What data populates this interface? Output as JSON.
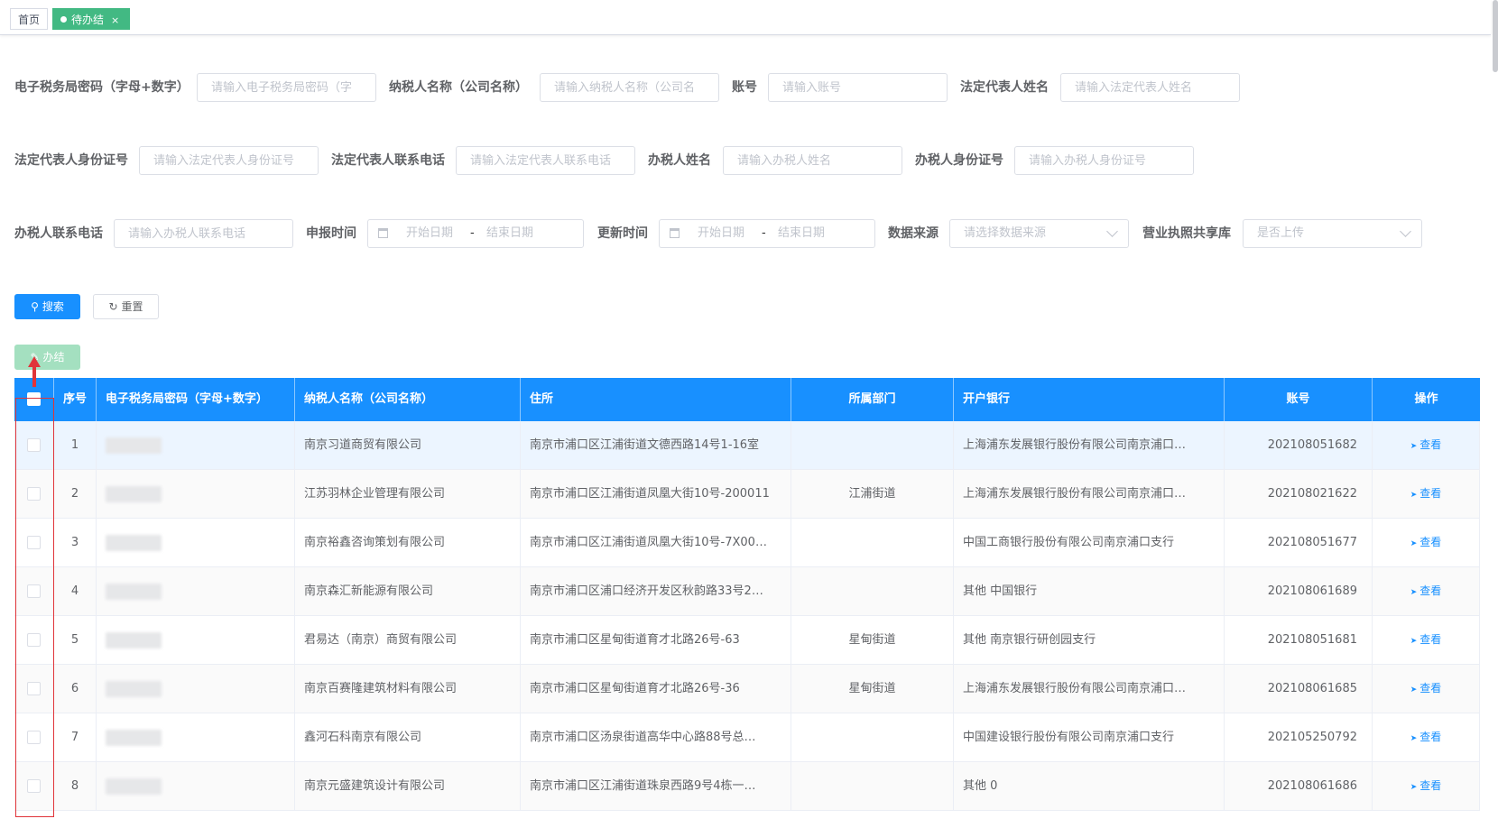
{
  "tabs": {
    "home": "首页",
    "active": "待办结",
    "close": "×"
  },
  "filters": {
    "row1": [
      {
        "label": "电子税务局密码（字母+数字）",
        "placeholder": "请输入电子税务局密码（字"
      },
      {
        "label": "纳税人名称（公司名称）",
        "placeholder": "请输入纳税人名称（公司名"
      },
      {
        "label": "账号",
        "placeholder": "请输入账号"
      },
      {
        "label": "法定代表人姓名",
        "placeholder": "请输入法定代表人姓名"
      }
    ],
    "row2": [
      {
        "label": "法定代表人身份证号",
        "placeholder": "请输入法定代表人身份证号"
      },
      {
        "label": "法定代表人联系电话",
        "placeholder": "请输入法定代表人联系电话"
      },
      {
        "label": "办税人姓名",
        "placeholder": "请输入办税人姓名"
      },
      {
        "label": "办税人身份证号",
        "placeholder": "请输入办税人身份证号"
      }
    ],
    "row3": {
      "contact_label": "办税人联系电话",
      "contact_placeholder": "请输入办税人联系电话",
      "report_label": "申报时间",
      "update_label": "更新时间",
      "start_placeholder": "开始日期",
      "sep": "-",
      "end_placeholder": "结束日期",
      "source_label": "数据来源",
      "source_placeholder": "请选择数据来源",
      "license_label": "营业执照共享库",
      "license_placeholder": "是否上传"
    }
  },
  "buttons": {
    "search": "搜索",
    "reset": "重置",
    "settle": "办结"
  },
  "table": {
    "headers": [
      "序号",
      "电子税务局密码（字母+数字）",
      "纳税人名称（公司名称）",
      "住所",
      "所属部门",
      "开户银行",
      "账号",
      "操作"
    ],
    "action_label": "查看",
    "rows": [
      {
        "no": "1",
        "name": "南京习道商贸有限公司",
        "address": "南京市浦口区江浦街道文德西路14号1-16室",
        "dept": "",
        "bank": "上海浦东发展银行股份有限公司南京浦口…",
        "account": "202108051682"
      },
      {
        "no": "2",
        "name": "江苏羽林企业管理有限公司",
        "address": "南京市浦口区江浦街道凤凰大街10号-200011",
        "dept": "江浦街道",
        "bank": "上海浦东发展银行股份有限公司南京浦口…",
        "account": "202108021622"
      },
      {
        "no": "3",
        "name": "南京裕鑫咨询策划有限公司",
        "address": "南京市浦口区江浦街道凤凰大街10号-7X00…",
        "dept": "",
        "bank": "中国工商银行股份有限公司南京浦口支行",
        "account": "202108051677"
      },
      {
        "no": "4",
        "name": "南京森汇新能源有限公司",
        "address": "南京市浦口区浦口经济开发区秋韵路33号2…",
        "dept": "",
        "bank": "其他  中国银行",
        "account": "202108061689"
      },
      {
        "no": "5",
        "name": "君易达（南京）商贸有限公司",
        "address": "南京市浦口区星甸街道育才北路26号-63",
        "dept": "星甸街道",
        "bank": "其他  南京银行研创园支行",
        "account": "202108051681"
      },
      {
        "no": "6",
        "name": "南京百赛隆建筑材料有限公司",
        "address": "南京市浦口区星甸街道育才北路26号-36",
        "dept": "星甸街道",
        "bank": "上海浦东发展银行股份有限公司南京浦口…",
        "account": "202108061685"
      },
      {
        "no": "7",
        "name": "鑫河石科南京有限公司",
        "address": "南京市浦口区汤泉街道高华中心路88号总…",
        "dept": "",
        "bank": "中国建设银行股份有限公司南京浦口支行",
        "account": "202105250792"
      },
      {
        "no": "8",
        "name": "南京元盛建筑设计有限公司",
        "address": "南京市浦口区江浦街道珠泉西路9号4栋一…",
        "dept": "",
        "bank": "其他  0",
        "account": "202108061686"
      }
    ]
  },
  "colors": {
    "primary": "#1890ff",
    "tab_active": "#42b983",
    "annotation": "#e0343a"
  }
}
